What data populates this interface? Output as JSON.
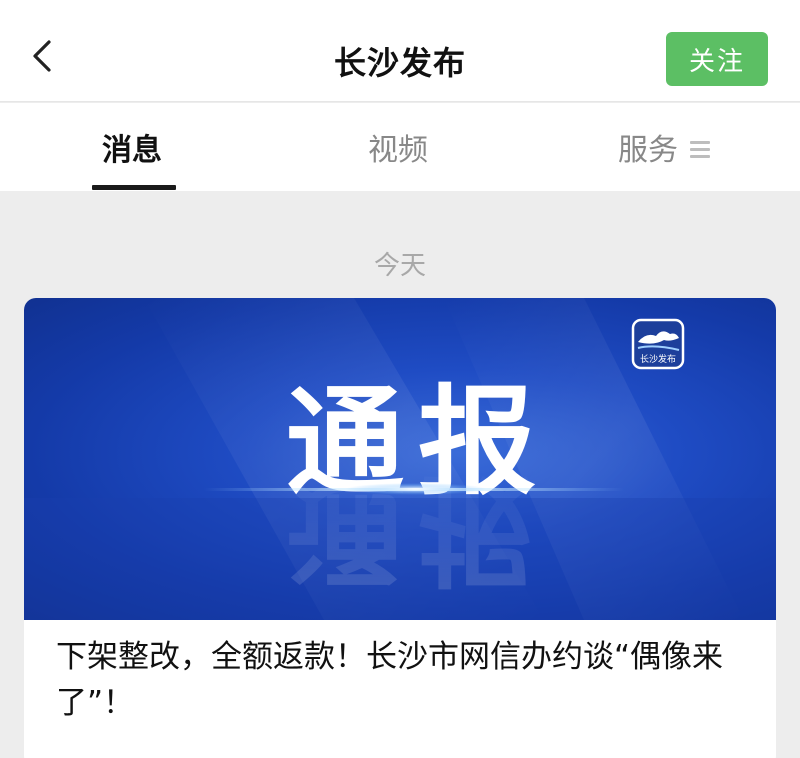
{
  "header": {
    "title": "长沙发布",
    "follow_label": "关注"
  },
  "tabs": [
    {
      "label": "消息",
      "active": true
    },
    {
      "label": "视频",
      "active": false
    },
    {
      "label": "服务",
      "active": false
    }
  ],
  "feed": {
    "date_separator": "今天",
    "article": {
      "banner_text": "通报",
      "logo_text": "长沙发布",
      "headline": "下架整改，全额返款！长沙市网信办约谈“偶像来了”！"
    }
  },
  "colors": {
    "accent_green": "#5cbf64",
    "banner_blue": "#1f4cc4"
  }
}
